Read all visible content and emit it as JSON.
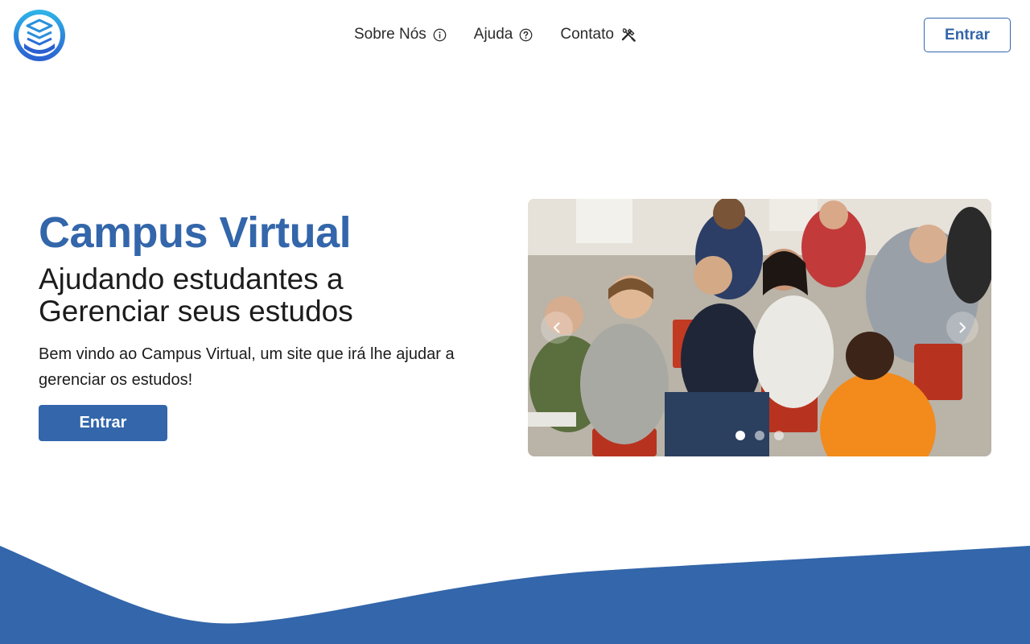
{
  "header": {
    "nav": [
      {
        "label": "Sobre Nós",
        "icon": "info-circle-icon"
      },
      {
        "label": "Ajuda",
        "icon": "question-circle-icon"
      },
      {
        "label": "Contato",
        "icon": "tools-icon"
      }
    ],
    "login_label": "Entrar"
  },
  "hero": {
    "title": "Campus Virtual",
    "subtitle_line1": "Ajudando estudantes a",
    "subtitle_line2": "Gerenciar seus estudos",
    "description": "Bem vindo ao Campus Virtual, um site que irá lhe ajudar a gerenciar os estudos!",
    "cta_label": "Entrar"
  },
  "carousel": {
    "slide_count": 3,
    "active_slide": 1
  },
  "colors": {
    "brand": "#3366aa",
    "text": "#1c1c1c",
    "background": "#ffffff"
  }
}
